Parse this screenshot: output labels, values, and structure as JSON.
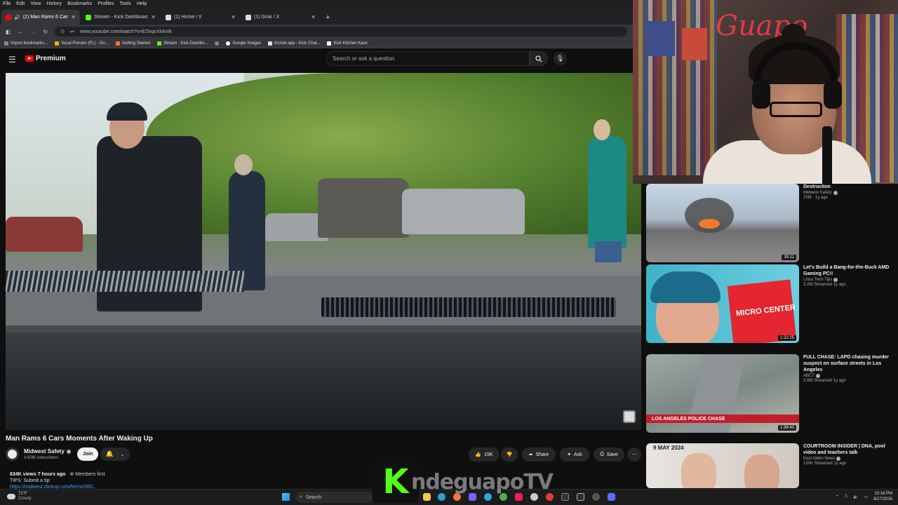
{
  "menu": [
    "File",
    "Edit",
    "View",
    "History",
    "Bookmarks",
    "Profiles",
    "Tools",
    "Help"
  ],
  "tabs": [
    {
      "title": "(2) Man Rams 6 Cars Mom",
      "favicon_color": "#ff0000",
      "active": true
    },
    {
      "title": "Stream - Kick Dashboard",
      "favicon_color": "#53fc18",
      "active": false
    },
    {
      "title": "(1) Home / X",
      "favicon_color": "#ffffff",
      "active": false
    },
    {
      "title": "(1) Grok / X",
      "favicon_color": "#ffffff",
      "active": false
    }
  ],
  "address": {
    "url": "www.youtube.com/watch?v=EZeqvXkAntk"
  },
  "bookmarks": [
    "Import bookmarks...",
    "Vocal Presets (FL) - Go...",
    "Getting Started",
    "Stream - Kick Dashbo...",
    "Google Images",
    "Kicklet.app - Kick Chat...",
    "Kick Kitchen Kaos"
  ],
  "yt": {
    "logo_text": "Premium",
    "search_placeholder": "Search or ask a question"
  },
  "video": {
    "title": "Man Rams 6 Cars Moments After Waking Up",
    "channel": "Midwest Safety",
    "subscribers": "4.63M subscribers",
    "join_label": "Join",
    "likes": "15K",
    "share_label": "Share",
    "ask_label": "Ask",
    "save_label": "Save",
    "views_line": "634K views  7 hours ago",
    "members_first": "Members first",
    "tip_line": "TIPS: Submit a tip:",
    "tip_link": "https://midwest.clickup.com/forms/900..."
  },
  "recommendations": [
    {
      "title": "Destruction",
      "channel": "Midwest Safety",
      "stats": "25M · 1y ago",
      "duration": "35:11"
    },
    {
      "title": "Let's Build a Bang-for-the-Buck AMD Gaming PC!!",
      "channel": "Linus Tech Tips",
      "stats": "3.2M  Streamed 1y ago",
      "duration": "1:22:25",
      "thumb_text": "MICRO CENTER"
    },
    {
      "title": "FULL CHASE: LAPD chasing murder suspect on surface streets in Los Angeles",
      "channel": "ABC7",
      "stats": "3.5M  Streamed 1y ago",
      "duration": "1:39:43",
      "thumb_text": "LOS ANGELES POLICE CHASE"
    },
    {
      "title": "COURTROOM INSIDER | DNA, pool video and teachers talk",
      "channel": "East Idaho News",
      "stats": "130K  Streamed 1y ago",
      "thumb_text": "9 MAY 2024"
    }
  ],
  "taskbar": {
    "temp": "71°F",
    "weather": "Cloudy",
    "search_label": "Search",
    "time": "10:18 PM",
    "date": "8/27/2026"
  },
  "overlay": {
    "name": "ndeguapoTV"
  }
}
